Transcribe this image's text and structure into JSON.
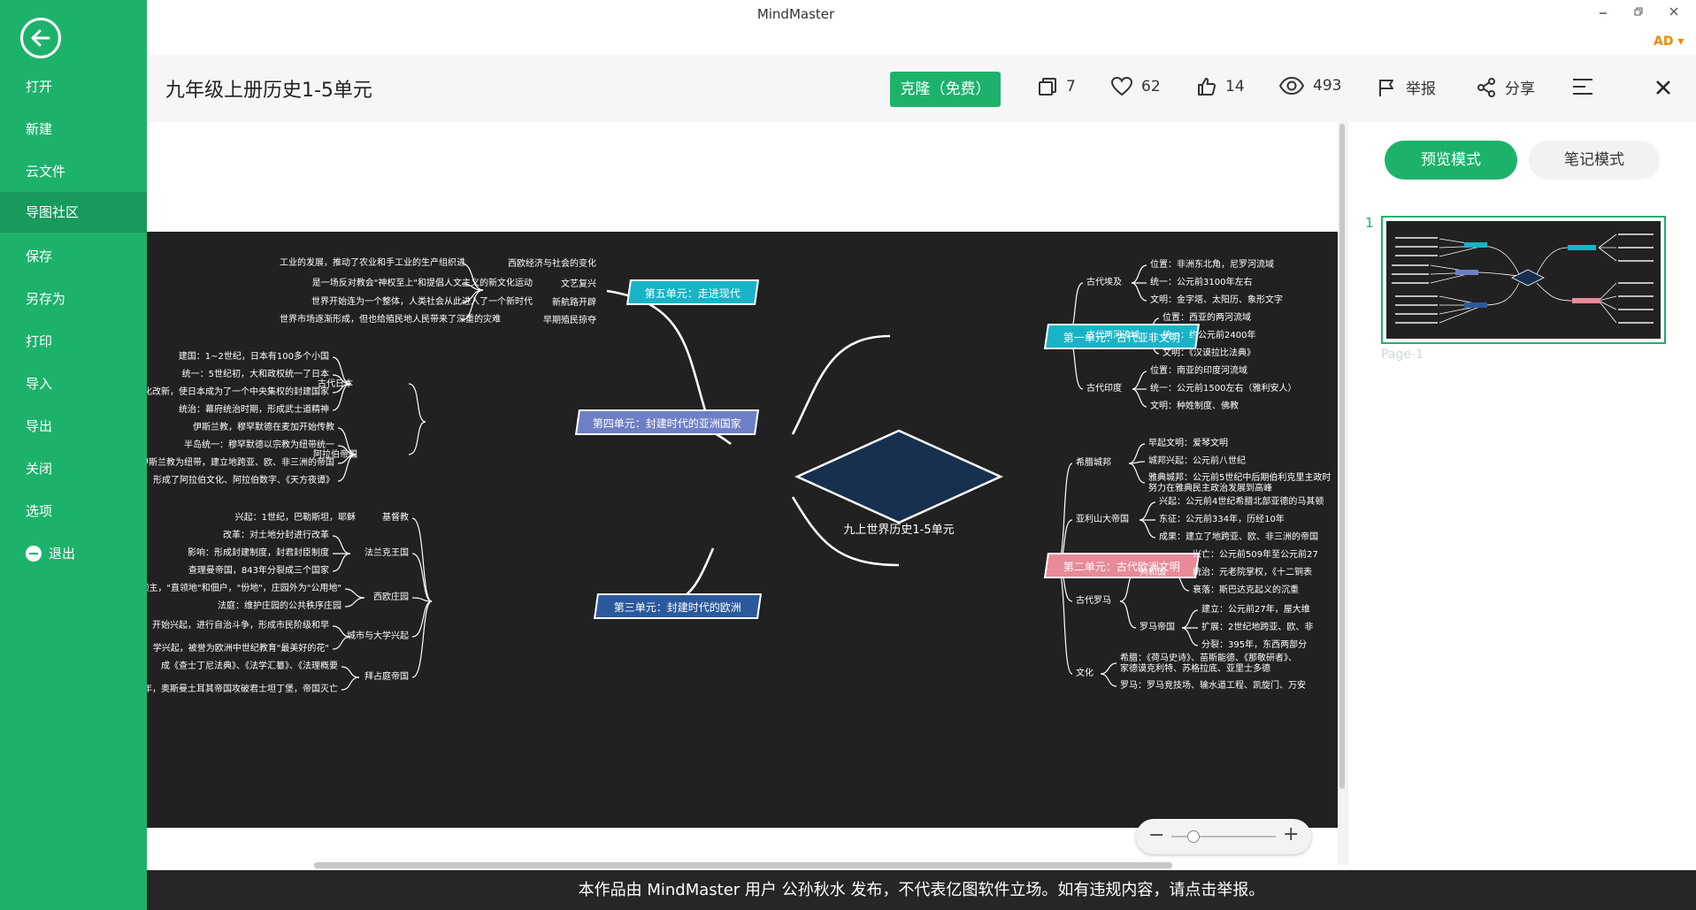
{
  "window": {
    "app_title": "MindMaster",
    "ad_badge": "AD"
  },
  "sidebar": {
    "items": [
      {
        "label": "打开"
      },
      {
        "label": "新建"
      },
      {
        "label": "云文件"
      },
      {
        "label": "导图社区"
      },
      {
        "label": "保存"
      },
      {
        "label": "另存为"
      },
      {
        "label": "打印"
      },
      {
        "label": "导入"
      },
      {
        "label": "导出"
      },
      {
        "label": "关闭"
      },
      {
        "label": "选项"
      },
      {
        "label": "退出"
      }
    ],
    "active": "导图社区"
  },
  "header": {
    "title": "九年级上册历史1-5单元",
    "clone_label": "克隆（免费）",
    "copies": "7",
    "favorites": "62",
    "likes": "14",
    "views": "493",
    "report_label": "举报",
    "share_label": "分享"
  },
  "mindmap": {
    "center": "九上世界历史1-5单元",
    "units": {
      "u1": "第一单元：古代亚非文明",
      "u2": "第二单元：古代欧洲文明",
      "u3": "第三单元：封建时代的欧洲",
      "u4": "第四单元：封建时代的亚洲国家",
      "u5": "第五单元：走进现代"
    },
    "u1_nodes": {
      "egypt": "古代埃及",
      "egypt_1": "位置：非洲东北角，尼罗河流域",
      "egypt_2": "统一：公元前3100年左右",
      "egypt_3": "文明：金字塔、太阳历、象形文字",
      "meso": "古代两河流域",
      "meso_1": "位置：西亚的两河流域",
      "meso_2": "统一：约公元前2400年",
      "meso_3": "文明：《汉谟拉比法典》",
      "india": "古代印度",
      "india_1": "位置：南亚的印度河流域",
      "india_2": "统一：公元前1500左右（雅利安人）",
      "india_3": "文明：种姓制度、佛教"
    },
    "u2_nodes": {
      "greece": "希腊城邦",
      "greece_1": "早起文明：爱琴文明",
      "greece_2": "城邦兴起：公元前八世纪",
      "greece_3a": "雅典城邦：公元前5世纪中后期伯利克里主政时",
      "greece_3b": "努力在雅典民主政治发展到高峰",
      "alex": "亚利山大帝国",
      "alex_1": "兴起：公元前4世纪希腊北部亚德的马其顿",
      "alex_2": "东征：公元前334年，历经10年",
      "alex_3": "成果：建立了地跨亚、欧、非三洲的帝国",
      "rome": "古代罗马",
      "republic": "共和国",
      "rep_1": "兴亡：公元前509年至公元前27",
      "rep_2": "统治：元老院掌权，《十二铜表",
      "rep_3": "衰落：斯巴达克起义的沉重",
      "empire": "罗马帝国",
      "emp_1": "建立：公元前27年，屋大维",
      "emp_2": "扩展：2世纪地跨亚、欧、非",
      "emp_3": "分裂：395年，东西两部分",
      "culture": "文化",
      "cul_1a": "希腊：《荷马史诗》、苗斯能德、《那敬研者》、",
      "cul_1b": "家德谟克利特、苏格拉底、亚里士多德",
      "cul_2": "罗马：罗马竞技场、输水道工程、凯旋门、万安"
    },
    "u3_nodes": {
      "christ": "基督教",
      "christ_1": "兴起：1世纪，巴勒斯坦，耶稣",
      "frank": "法兰克王国",
      "frank_1": "改革：对土地分封进行改革",
      "frank_2": "影响：形成封建制度，封君封臣制度",
      "frank_3": "查理曼帝国，843年分裂成三个国家",
      "manor": "西欧庄园",
      "manor_1": "领主，\"直领地\"和佃户，\"份地\"，庄园外为\"公用地\"",
      "manor_2": "法庭：维护庄园的公共秩序庄园",
      "city": "城市与大学兴起",
      "city_1": "开始兴起，进行自治斗争，形成市民阶级和早",
      "city_2": "学兴起，被誉为欧洲中世纪教育\"最美好的花\"",
      "byz": "拜占庭帝国",
      "byz_1": "成《查士丁尼法典》、《法学汇纂》、《法理概要",
      "byz_2": "年，奥斯曼土耳其帝国攻破君士坦丁堡，帝国灭亡"
    },
    "u4_nodes": {
      "japan": "古代日本",
      "japan_1": "建国：1~2世纪，日本有100多个小国",
      "japan_2": "统一：5世纪初，大和政权统一了日本",
      "japan_3": "大化改新，使日本成为了一个中央集权的封建国家",
      "japan_4": "统治：幕府统治时期，形成武士道精神",
      "arab": "阿拉伯帝国",
      "arab_1": "伊斯兰教，穆罕默德在麦加开始传教",
      "arab_2": "半岛统一：穆罕默德以宗教为纽带统一",
      "arab_3": "以伊斯兰教为纽带，建立地跨亚、欧、非三洲的帝国",
      "arab_4": "形成了阿拉伯文化、阿拉伯数字、《天方夜谭》"
    },
    "u5_nodes": {
      "west": "西欧经济与社会的变化",
      "west_1": "工业的发展，推动了农业和手工业的生产组织进",
      "ren": "文艺复兴",
      "ren_1": "是一场反对教会\"神权至上\"和提倡人文主义的新文化运动",
      "route": "新航路开辟",
      "route_1": "世界开始连为一个整体，人类社会从此进入了一个新时代",
      "colony": "早期殖民掠夺",
      "colony_1": "世界市场逐渐形成，但也给殖民地人民带来了深重的灾难"
    }
  },
  "panel": {
    "preview_mode": "预览模式",
    "notes_mode": "笔记模式",
    "page_number": "1",
    "page_label": "Page-1"
  },
  "footer": {
    "notice": "本作品由 MindMaster 用户 公孙秋水 发布，不代表亿图软件立场。如有违规内容，请点击举报。"
  },
  "colors": {
    "accent": "#1db26b",
    "canvas_bg": "#212121",
    "u1": "#19b3c8",
    "u2": "#e88a97",
    "u3": "#2b5a9c",
    "u4": "#6f7fc6",
    "u5": "#19b3c8",
    "center": "#17304f"
  }
}
